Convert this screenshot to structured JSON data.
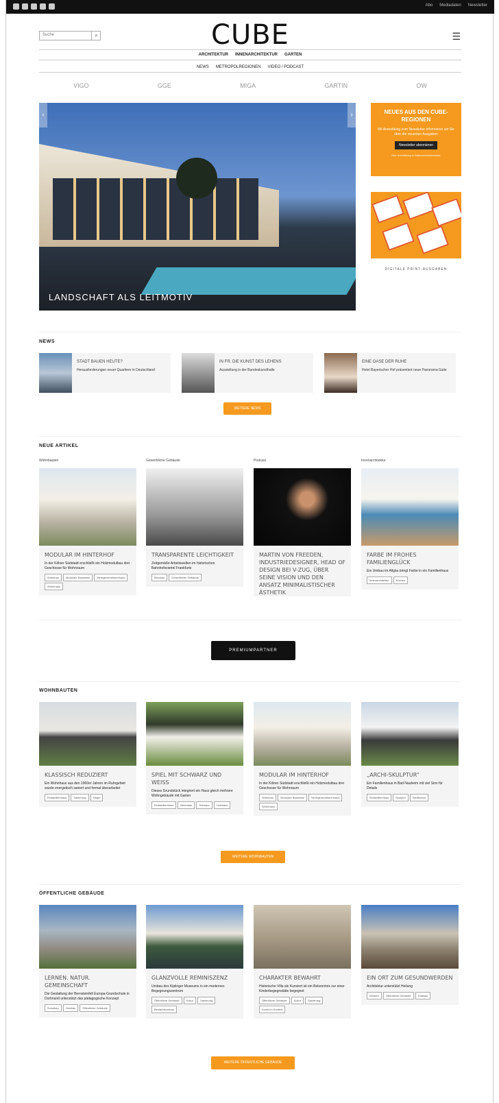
{
  "topbar": {
    "links": [
      "Abo",
      "Mediadaten",
      "Newsletter"
    ]
  },
  "search": {
    "placeholder": "Suche"
  },
  "logo": "CUBE",
  "nav_primary": [
    "ARCHITEKTUR",
    "INNENARCHITEKTUR",
    "GARTEN"
  ],
  "nav_secondary": [
    "NEWS",
    "METROPOLREGIONEN",
    "VIDEO / PODCAST"
  ],
  "partners": [
    "VIGO",
    "GGE",
    "MIGA",
    "GARTIN",
    "OW"
  ],
  "hero": {
    "caption": "LANDSCHAFT ALS LEITMOTIV"
  },
  "promo": {
    "title": "NEUES AUS DEN CUBE-REGIONEN",
    "desc": "Mit Anmeldung zum Newsletter informieren wir Sie über die neuesten Ausgaben",
    "button": "Newsletter abonnieren",
    "small": "Hier Anmeldung & Datenschutzhinweise"
  },
  "mag_caption": "DIGITALE PRINT-AUSGABEN",
  "news": {
    "title": "NEWS",
    "items": [
      {
        "headline": "STADT BAUEN HEUTE?",
        "text": "Herausforderungen neuer Quartiere in Deutschland"
      },
      {
        "headline": "IN FR. DIE KUNST DES LEHENS",
        "text": "Ausstellung in der Bundeskunsthalle"
      },
      {
        "headline": "EINE OASE DER RUHE",
        "text": "Hotel Bayerischer Hof präsentiert neue Panorama-Suite"
      }
    ],
    "more": "WEITERE NEWS"
  },
  "new_articles": {
    "title": "NEUE ARTIKEL",
    "items": [
      {
        "category": "Wohnbauten",
        "headline": "MODULAR IM HINTERHOF",
        "text": "In der Kölner Südstadt erschließt ein Holzmodulbau drei Geschosse für Wohnraum",
        "tags": [
          "Wohnbau",
          "Modulare Bauweise",
          "Mehrgenerationenhaus",
          "Wohnhaus"
        ]
      },
      {
        "category": "Gewerbliche Gebäude",
        "headline": "TRANSPARENTE LEICHTIGKEIT",
        "text": "Zeitgemäße Arbeitswelten im historischen Bahnhofsviertel Frankfurts",
        "tags": [
          "Bürobau",
          "Gewerbliche Gebäude"
        ]
      },
      {
        "category": "Podcast",
        "headline": "MARTIN VON FREEDEN, INDUSTRIEDESIGNER, HEAD OF DESIGN BEI V-ZUG, ÜBER SEINE VISION UND DEN ANSATZ MINIMALISTISCHER ÄSTHETIK",
        "text": "",
        "tags": []
      },
      {
        "category": "Innenarchitektur",
        "headline": "FARBE IM FROHES FAMILIENGLÜCK",
        "text": "Ein Umbau im Allgäu bringt Farbe in ein Familienhaus",
        "tags": [
          "Innenarchitektur",
          "Küchen"
        ]
      }
    ]
  },
  "premium": "PREMIUMPARTNER",
  "wohnbauten": {
    "title": "WOHNBAUTEN",
    "items": [
      {
        "headline": "KLASSISCH REDUZIERT",
        "text": "Ein Wohnhaus aus den 1960er Jahren im Ruhrgebiet wurde energetisch saniert und formal überarbeitet",
        "tags": [
          "Einfamilienhaus",
          "Sanierung",
          "Ziegel"
        ]
      },
      {
        "headline": "SPIEL MIT SCHWARZ UND WEISS",
        "text": "Dieses Grundstück integriert ein Haus gleich mehrere Wohngebäude mit Garten",
        "tags": [
          "Einfamilienhaus",
          "Betonbau",
          "Schwarz",
          "Holzhaus"
        ]
      },
      {
        "headline": "MODULAR IM HINTERHOF",
        "text": "In der Kölner Südstadt erschließt ein Holzmodulbau drei Geschosse für Wohnraum",
        "tags": [
          "Wohnbau",
          "Modulare Bauweise",
          "Mehrgenerationenhaus",
          "Wohnhaus"
        ]
      },
      {
        "headline": "„ARCHI-SKULPTUR“",
        "text": "Ein Familienhaus in Bad Nauheim mit viel Sinn für Details",
        "tags": [
          "Einfamilienhaus",
          "Skulptur",
          "Weißbeton"
        ]
      }
    ],
    "more": "WEITERE WOHNBAUTEN"
  },
  "public": {
    "title": "ÖFFENTLICHE GEBÄUDE",
    "items": [
      {
        "headline": "LERNEN. NATUR. GEMEINSCHAFT",
        "text": "Die Gestaltung der Bernsteinfelt Europa-Grundschule in Dortmund unterstützt das pädagogische Konzept",
        "tags": [
          "Schulbau",
          "Holzbau",
          "Öffentliche Gebäude"
        ]
      },
      {
        "headline": "GLANZVOLLE REMINISZENZ",
        "text": "Umbau des Kiplinger Museums in ein modernes Begegnungszentrum",
        "tags": [
          "Öffentliche Gebäude",
          "Kultur",
          "Sanierung",
          "Bestandsumbau"
        ]
      },
      {
        "headline": "CHARAKTER BEWAHRT",
        "text": "Historische Villa als Kunstort ist ein Bekenntnis zur einer Kinderbegegnstätte begegnet",
        "tags": [
          "Öffentliche Gebäude",
          "Kultur",
          "Sanierung",
          "Kunst im Kontext"
        ]
      },
      {
        "headline": "EIN ORT ZUM GESUNDWERDEN",
        "text": "Architektur unterstützt Heilung",
        "tags": [
          "Kliniken",
          "Öffentliche Gebäude",
          "Holzbau"
        ]
      }
    ],
    "more": "WEITERE ÖFFENTLICHE GEBÄUDE"
  }
}
